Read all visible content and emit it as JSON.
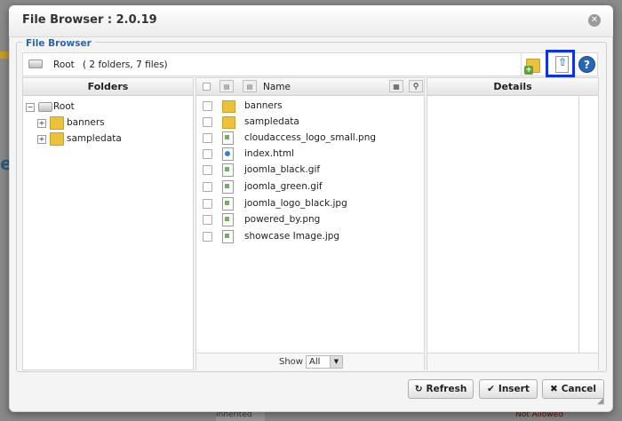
{
  "dialog": {
    "title": "File Browser : 2.0.19",
    "legend": "File Browser",
    "close_icon": "close-icon"
  },
  "toolbar": {
    "path_label": "Root",
    "path_info": "( 2 folders, 7 files)",
    "icons": [
      "drive-icon",
      "new-folder-icon",
      "upload-icon",
      "help-icon"
    ],
    "help_label": "?"
  },
  "folders_pane": {
    "header": "Folders",
    "root": "Root",
    "items": [
      {
        "label": "banners"
      },
      {
        "label": "sampledata"
      }
    ]
  },
  "files_pane": {
    "name_header": "Name",
    "rows": [
      {
        "name": "banners",
        "type": "folder"
      },
      {
        "name": "sampledata",
        "type": "folder"
      },
      {
        "name": "cloudaccess_logo_small.png",
        "type": "image"
      },
      {
        "name": "index.html",
        "type": "html"
      },
      {
        "name": "joomla_black.gif",
        "type": "image"
      },
      {
        "name": "joomla_green.gif",
        "type": "image"
      },
      {
        "name": "joomla_logo_black.jpg",
        "type": "image"
      },
      {
        "name": "powered_by.png",
        "type": "image"
      },
      {
        "name": "showcase Image.jpg",
        "type": "image"
      }
    ],
    "show_label": "Show",
    "show_value": "All"
  },
  "details_pane": {
    "header": "Details"
  },
  "buttons": {
    "refresh": "Refresh",
    "insert": "Insert",
    "cancel": "Cancel"
  },
  "background": {
    "letter": "e",
    "inherited": "Inherited",
    "not_allowed": "Not Allowed"
  },
  "colors": {
    "accent_blue": "#2b67a8",
    "highlight_box": "#1030e8",
    "folder_yellow": "#ecc13c"
  }
}
